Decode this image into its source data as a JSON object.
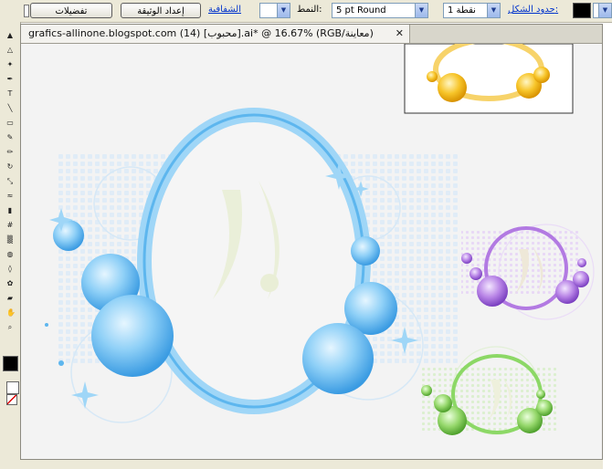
{
  "control_bar": {
    "options_button": "تفضيلات",
    "document_setup_button": "إعداد الوثيقة",
    "transparency_link": "الشفافية",
    "style_label": "النمط:",
    "stroke_combo": "5 pt Round",
    "points_combo": "1 نقطة",
    "stroke_link": "حدود الشكل:"
  },
  "document": {
    "tab_title": "grafics-allinone.blogspot.com (14) [محبوب].ai* @ 16.67% (RGB/معاينة)",
    "close_glyph": "✕"
  },
  "toolbox": {
    "icons": [
      "selection-icon",
      "direct-selection-icon",
      "magic-wand-icon",
      "pen-icon",
      "type-icon",
      "line-icon",
      "rectangle-icon",
      "paintbrush-icon",
      "pencil-icon",
      "rotate-icon",
      "scale-icon",
      "warp-icon",
      "graph-icon",
      "mesh-icon",
      "gradient-icon",
      "eyedropper-icon",
      "blend-icon",
      "symbol-icon",
      "slice-icon",
      "hand-icon",
      "zoom-icon"
    ],
    "fill_color": "#000000",
    "stroke_color": "#ffffff"
  },
  "artwork": {
    "frames": [
      {
        "name": "blue-frame",
        "color": "#7cc5f2"
      },
      {
        "name": "purple-frame",
        "color": "#a86ad8"
      },
      {
        "name": "green-frame",
        "color": "#7fcf5a"
      },
      {
        "name": "yellow-frame",
        "color": "#f4b81a"
      }
    ]
  }
}
